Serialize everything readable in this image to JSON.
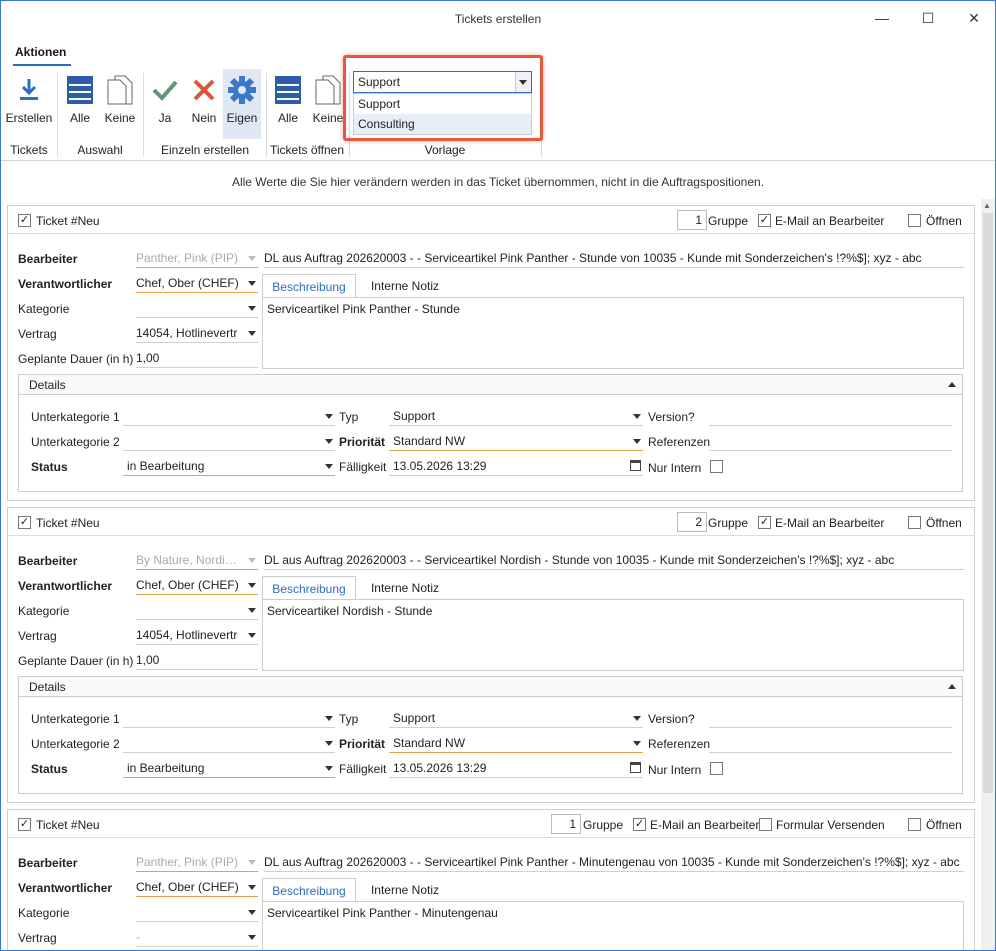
{
  "window": {
    "title": "Tickets erstellen",
    "minimize": "—",
    "maximize": "☐",
    "close": "✕"
  },
  "ribbon": {
    "tab": "Aktionen",
    "buttons": {
      "erstellen": "Erstellen",
      "alle1": "Alle",
      "keine1": "Keine",
      "ja": "Ja",
      "nein": "Nein",
      "eigen": "Eigen",
      "alle2": "Alle",
      "keine2": "Keine"
    },
    "groups": {
      "tickets": "Tickets",
      "auswahl": "Auswahl",
      "einzeln": "Einzeln erstellen",
      "oeffnen": "Tickets öffnen",
      "vorlage": "Vorlage"
    },
    "vorlage": {
      "selected": "Support",
      "options": [
        "Support",
        "Consulting"
      ]
    }
  },
  "info": "Alle Werte die Sie hier verändern werden in das Ticket übernommen, nicht in die Auftragspositionen.",
  "labels": {
    "ticket": "Ticket #Neu",
    "gruppe": "Gruppe",
    "email": "E-Mail an Bearbeiter",
    "oeffnen": "Öffnen",
    "formular": "Formular Versenden",
    "bearbeiter": "Bearbeiter",
    "verantwortlicher": "Verantwortlicher",
    "kategorie": "Kategorie",
    "vertrag": "Vertrag",
    "dauer": "Geplante Dauer (in h)",
    "beschreibung": "Beschreibung",
    "notiz": "Interne Notiz",
    "details": "Details",
    "unterkat1": "Unterkategorie 1",
    "unterkat2": "Unterkategorie 2",
    "status": "Status",
    "typ": "Typ",
    "prioritaet": "Priorität",
    "faelligkeit": "Fälligkeit",
    "version": "Version?",
    "referenzen": "Referenzen",
    "intern": "Nur Intern"
  },
  "tickets": [
    {
      "gruppe": "1",
      "bearbeiter": "Panther, Pink (PIP)",
      "subject": "DL aus Auftrag 202620003 -    - Serviceartikel Pink Panther - Stunde  von 10035 - Kunde mit Sonderzeichen's !?%$]; xyz - abc",
      "verantwortlicher": "Chef, Ober (CHEF)",
      "kategorie": "",
      "vertrag": "14054, Hotlinevertr",
      "dauer": "1,00",
      "beschreibung": "Serviceartikel Pink Panther - Stunde",
      "status": "in Bearbeitung",
      "typ": "Support",
      "prioritaet": "Standard NW",
      "faelligkeit": "13.05.2026 13:29"
    },
    {
      "gruppe": "2",
      "bearbeiter": "By Nature, Nordi…",
      "subject": "DL aus Auftrag 202620003 -    - Serviceartikel Nordish - Stunde  von 10035 - Kunde mit Sonderzeichen's !?%$]; xyz - abc",
      "verantwortlicher": "Chef, Ober (CHEF)",
      "kategorie": "",
      "vertrag": "14054, Hotlinevertr",
      "dauer": "1,00",
      "beschreibung": "Serviceartikel Nordish - Stunde",
      "status": "in Bearbeitung",
      "typ": "Support",
      "prioritaet": "Standard NW",
      "faelligkeit": "13.05.2026 13:29"
    },
    {
      "gruppe": "1",
      "bearbeiter": "Panther, Pink (PIP)",
      "subject": "DL aus Auftrag 202620003 -    - Serviceartikel Pink Panther - Minutengenau von 10035 - Kunde mit Sonderzeichen's !?%$]; xyz - abc",
      "verantwortlicher": "Chef, Ober (CHEF)",
      "kategorie": "",
      "vertrag": "-",
      "beschreibung": "Serviceartikel Pink Panther - Minutengenau"
    }
  ]
}
